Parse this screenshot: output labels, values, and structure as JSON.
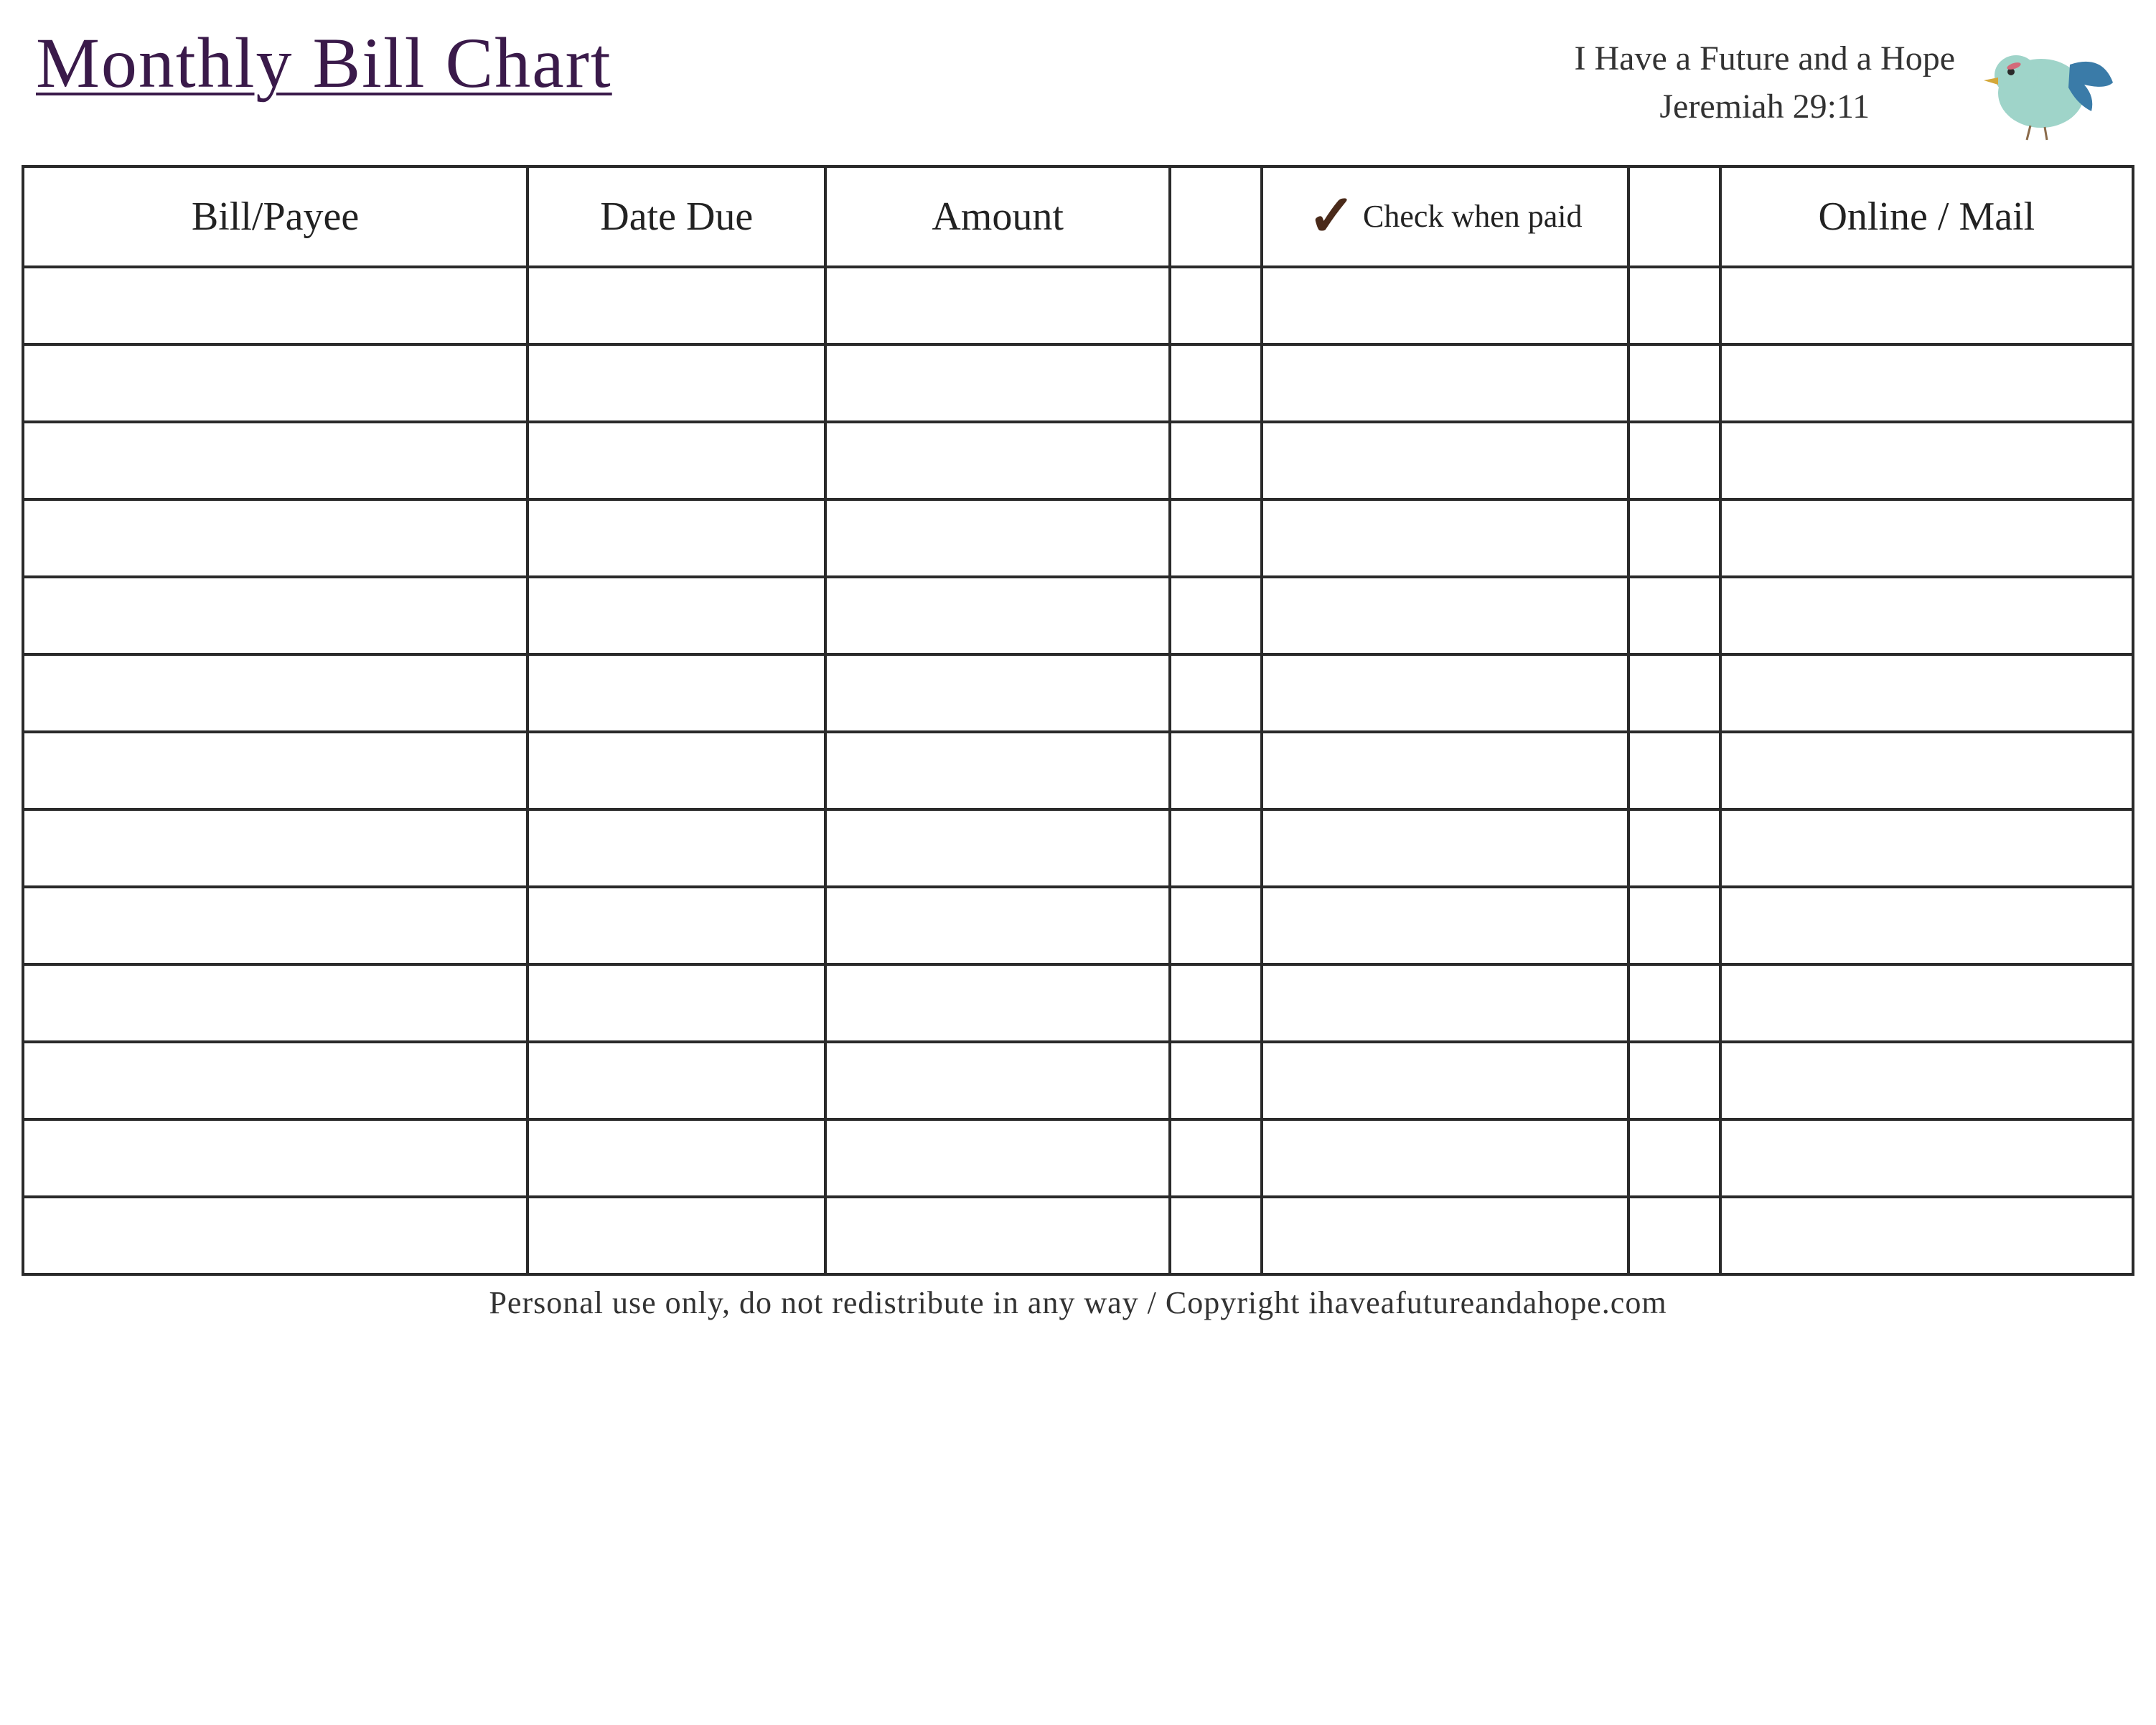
{
  "header": {
    "title": "Monthly Bill Chart",
    "verse_line1": "I Have a Future and a Hope",
    "verse_line2": "Jeremiah 29:11"
  },
  "columns": {
    "payee": "Bill/Payee",
    "date_due": "Date Due",
    "amount": "Amount",
    "check_when_paid": "Check when paid",
    "online_mail": "Online / Mail"
  },
  "row_count": 13,
  "footer": "Personal use only, do not redistribute in any way / Copyright ihaveafutureandahope.com",
  "icons": {
    "checkmark": "✓",
    "bird": "bird-icon"
  },
  "colors": {
    "title": "#3a1a4a",
    "border": "#2a2a2a",
    "bird_body": "#9fd4c9",
    "bird_wing": "#3a7ba8",
    "bird_beak": "#d4a83a"
  }
}
